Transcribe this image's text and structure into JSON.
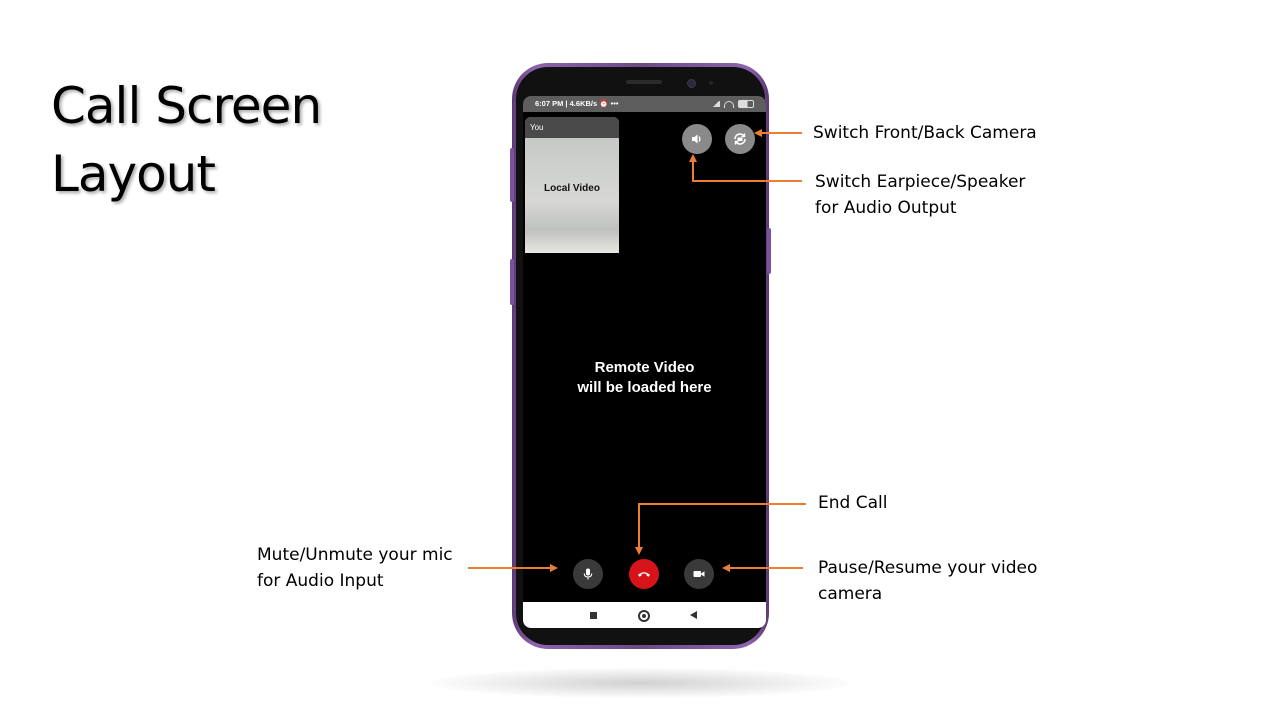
{
  "slide": {
    "title_line1": "Call Screen",
    "title_line2": "Layout"
  },
  "phone": {
    "status_bar": {
      "time": "6:07 PM | 4.6KB/s",
      "extra": "⏰ •••"
    },
    "local_video": {
      "label": "You",
      "text": "Local Video"
    },
    "remote_video": {
      "line1": "Remote Video",
      "line2": "will be loaded here"
    },
    "buttons": {
      "speaker_icon": "speaker-icon",
      "camera_switch_icon": "camera-switch-icon",
      "mic_icon": "mic-icon",
      "end_call_icon": "end-call-icon",
      "video_icon": "video-camera-icon"
    },
    "colors": {
      "end_call": "#d8141b",
      "phone_frame": "#8e63ad",
      "annotation_arrow": "#ed7d31"
    }
  },
  "annotations": {
    "switch_camera": "Switch Front/Back Camera",
    "switch_audio_line1": "Switch Earpiece/Speaker",
    "switch_audio_line2": "for Audio Output",
    "end_call": "End Call",
    "mute_line1": "Mute/Unmute your mic",
    "mute_line2": "for Audio Input",
    "pause_line1": "Pause/Resume your video",
    "pause_line2": "camera"
  }
}
